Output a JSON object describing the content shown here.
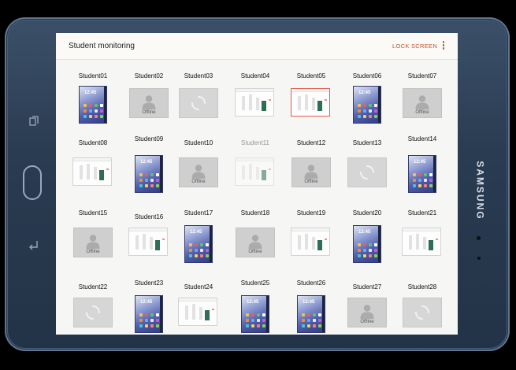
{
  "device": {
    "brand": "SAMSUNG"
  },
  "appbar": {
    "title": "Student monitoring",
    "lock_label": "LOCK SCREEN"
  },
  "offline_text": "Offline",
  "home_clock": "12:45",
  "colors": {
    "accent": "#c3512f",
    "selected_border": "#e55a4a",
    "green_block": "#2e6e55"
  },
  "students": [
    {
      "name": "Student01",
      "state": "home"
    },
    {
      "name": "Student02",
      "state": "offline"
    },
    {
      "name": "Student03",
      "state": "loading"
    },
    {
      "name": "Student04",
      "state": "app"
    },
    {
      "name": "Student05",
      "state": "app",
      "selected": true
    },
    {
      "name": "Student06",
      "state": "home"
    },
    {
      "name": "Student07",
      "state": "offline"
    },
    {
      "name": "Student08",
      "state": "app"
    },
    {
      "name": "Student09",
      "state": "home"
    },
    {
      "name": "Student10",
      "state": "offline"
    },
    {
      "name": "Student11",
      "state": "app",
      "dim": true
    },
    {
      "name": "Student12",
      "state": "offline"
    },
    {
      "name": "Student13",
      "state": "loading"
    },
    {
      "name": "Student14",
      "state": "home"
    },
    {
      "name": "Student15",
      "state": "offline"
    },
    {
      "name": "Student16",
      "state": "app"
    },
    {
      "name": "Student17",
      "state": "home"
    },
    {
      "name": "Student18",
      "state": "offline"
    },
    {
      "name": "Student19",
      "state": "app"
    },
    {
      "name": "Student20",
      "state": "home"
    },
    {
      "name": "Student21",
      "state": "app"
    },
    {
      "name": "Student22",
      "state": "loading"
    },
    {
      "name": "Student23",
      "state": "home"
    },
    {
      "name": "Student24",
      "state": "app"
    },
    {
      "name": "Student25",
      "state": "home"
    },
    {
      "name": "Student26",
      "state": "home"
    },
    {
      "name": "Student27",
      "state": "offline"
    },
    {
      "name": "Student28",
      "state": "loading"
    }
  ]
}
